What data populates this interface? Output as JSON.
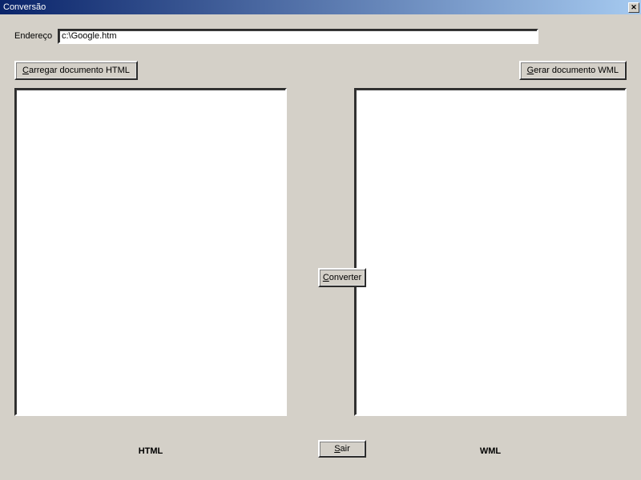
{
  "title": "Conversão",
  "address": {
    "label": "Endereço",
    "value": "c:\\Google.htm"
  },
  "buttons": {
    "load_html_pre": "C",
    "load_html_rest": "arregar documento HTML",
    "gen_wml_pre": "G",
    "gen_wml_rest": "erar documento WML",
    "convert_pre": "C",
    "convert_rest": "onverter",
    "exit_pre": "S",
    "exit_rest": "air"
  },
  "labels": {
    "html": "HTML",
    "wml": "WML"
  },
  "panels": {
    "html_content": "",
    "wml_content": ""
  }
}
